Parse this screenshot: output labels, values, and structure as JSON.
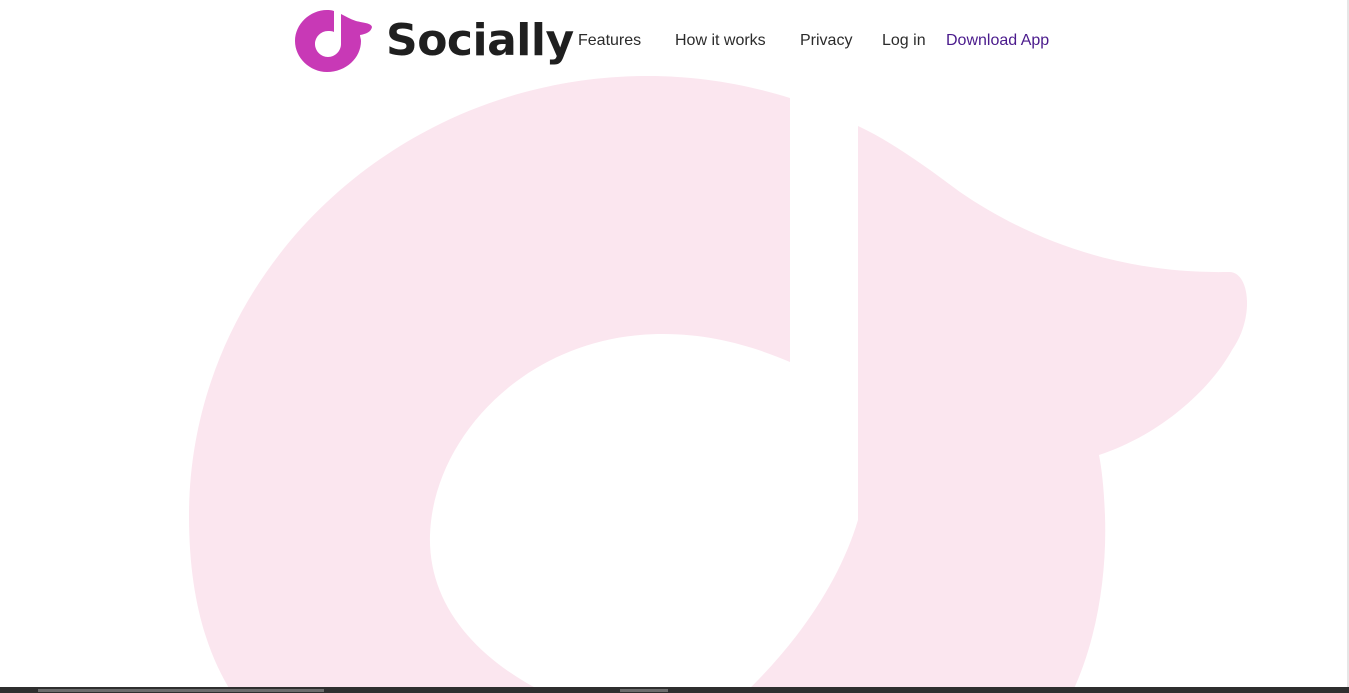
{
  "brand": {
    "name": "Socially",
    "logo_icon": "music-note-bubble-logo"
  },
  "nav": {
    "features": "Features",
    "how_it_works": "How it works",
    "privacy": "Privacy",
    "login": "Log in",
    "download": "Download App"
  },
  "colors": {
    "brand_magenta": "#c839b6",
    "hero_pink": "#fbe6ef",
    "text_dark": "#1f1f1f",
    "accent_link": "#4a1a8c"
  }
}
